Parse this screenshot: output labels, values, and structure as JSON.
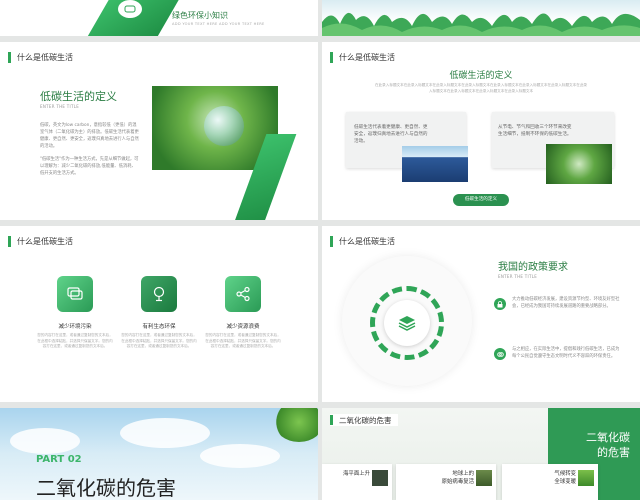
{
  "slide1": {
    "title": "绿色环保小知识",
    "sub1": "ADD YOUR TEXT HERE ADD YOUR TEXT HERE",
    "icon": "chat-icon"
  },
  "slide3": {
    "header": "什么是低碳生活",
    "title": "低碳生活的定义",
    "subtitle": "ENTER THE TITLE",
    "para1": "低碳，英文为low carbon，意指较低（更低）的温室气体（二氧化碳为主）的排放。低碳生活代表着更健康、更自然、更安全，返璞归真地去进行人与自然的活动。",
    "para2": "\"低碳生活\"作为一种生活方式，先是从细节做起，可以理解为：减少二氧化碳的排放,低能量、低消耗、低开支的生活方式。"
  },
  "slide4": {
    "header": "什么是低碳生活",
    "title": "低碳生活的定义",
    "intro": "在此录入标题文本在此录入标题文本在此录入标题文本在此录入标题文本在此录入标题文本在此录入标题文本在此录入标题文本在此录入标题文本在此录入标题文本在此录入标题文本在此录入标题文本",
    "card1": "低碳生活代表着更健康、更自然、更安全，返璞归真地去进行人与自然的活动。",
    "card2": "从节电、节气和回收三个环节来改变生活细节，抵制不环保的低碳生活。",
    "button": "低碳生活的定义"
  },
  "slide5": {
    "header": "什么是低碳生活",
    "features": [
      {
        "label": "减少环境污染",
        "icon": "chat-icon",
        "text": "您的内容打在这里，或者通过复制您的文本后，在此框中选择粘贴，并选择只保留文字。您的内容打在这里，或者通过复制您的文本后。"
      },
      {
        "label": "有利生态环保",
        "icon": "bulb-icon",
        "text": "您的内容打在这里，或者通过复制您的文本后，在此框中选择粘贴，并选择只保留文字。您的内容打在这里，或者通过复制您的文本后。"
      },
      {
        "label": "减少资源浪费",
        "icon": "share-icon",
        "text": "您的内容打在这里，或者通过复制您的文本后，在此框中选择粘贴，并选择只保留文字。您的内容打在这里，或者通过复制您的文本后。"
      }
    ]
  },
  "slide6": {
    "header": "什么是低碳生活",
    "title": "我国的政策要求",
    "subtitle": "ENTER THE TITLE",
    "bullet1": "大力推动低碳经济发展，建设资源节约型、环境友好型社会，已经成为我国可持续发展道路的重要战略部分。",
    "bullet2": "与之相应，在实际生活中，提倡和践行低碳生活，已成为每个公民自觉遵守生态文明时代义不容辞的环保责任。"
  },
  "slide7": {
    "part": "PART 02",
    "title": "二氧化碳的危害"
  },
  "slide8": {
    "header": "二氧化碳的危害",
    "side": [
      "二氧化碳",
      "的危害"
    ],
    "cards": [
      {
        "title": [
          "海平面上升"
        ]
      },
      {
        "title": [
          "地球上的",
          "原始病毒复活"
        ]
      },
      {
        "title": [
          "气候转变",
          "全球变暖"
        ]
      }
    ]
  }
}
